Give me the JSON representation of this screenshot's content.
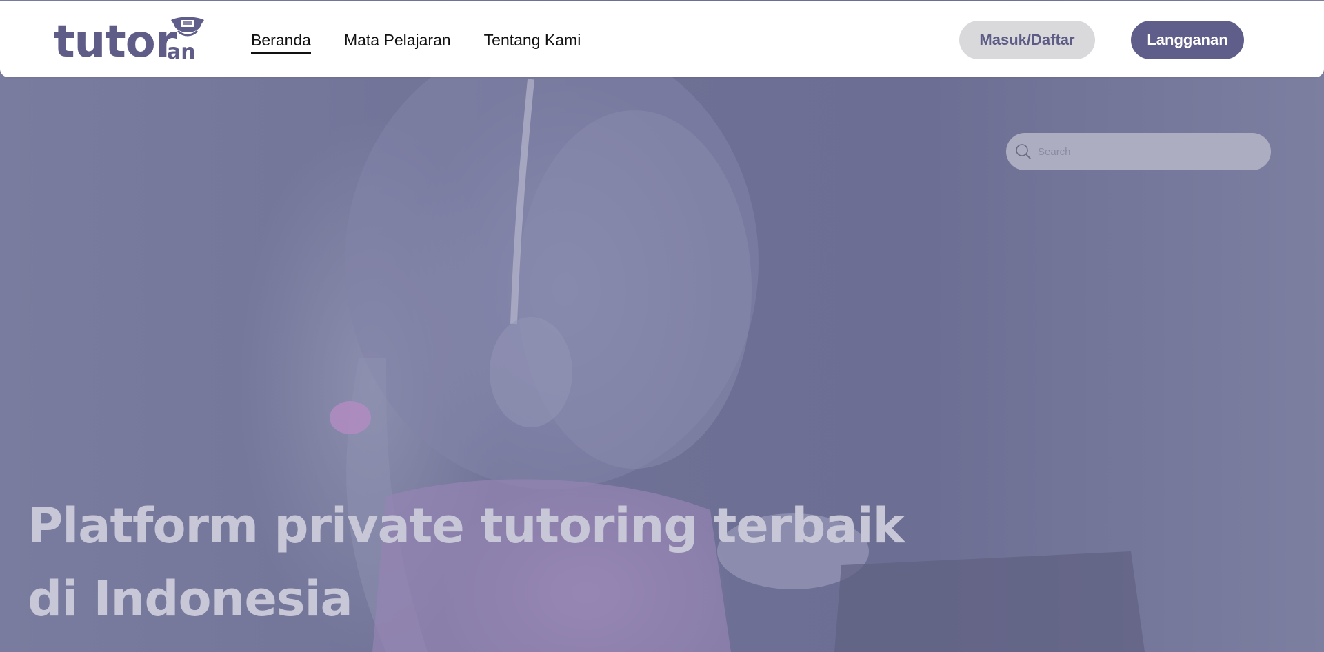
{
  "header": {
    "logo": {
      "text": "tutor",
      "suffix": "an"
    },
    "nav": [
      {
        "label": "Beranda",
        "active": true
      },
      {
        "label": "Mata Pelajaran",
        "active": false
      },
      {
        "label": "Tentang Kami",
        "active": false
      }
    ],
    "login_label": "Masuk/Daftar",
    "subscribe_label": "Langganan"
  },
  "search": {
    "placeholder": "Search",
    "value": ""
  },
  "hero": {
    "headline": "Platform private tutoring terbaik di Indonesia"
  },
  "icons": {
    "search": "search-icon",
    "logo_mascot": "mascot-icon"
  },
  "colors": {
    "brand": "#5f5d89",
    "header_bg": "#ffffff",
    "login_bg": "#d9d9dc",
    "hero_tint": "#6f7196",
    "headline": "#c7c7d7"
  }
}
